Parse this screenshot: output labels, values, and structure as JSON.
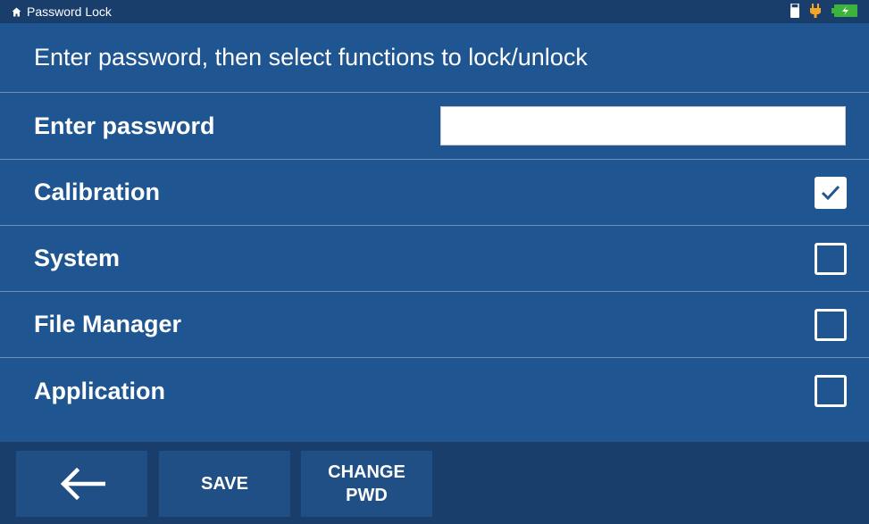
{
  "statusbar": {
    "title": "Password Lock",
    "icons": [
      "home-icon",
      "usb-icon",
      "power-plug-icon",
      "battery-charging-icon"
    ],
    "colors": {
      "plug": "#f5a623",
      "battery": "#3cb43c"
    }
  },
  "heading": "Enter password, then select functions to lock/unlock",
  "password": {
    "label": "Enter password",
    "value": "",
    "placeholder": ""
  },
  "functions": [
    {
      "label": "Calibration",
      "checked": true
    },
    {
      "label": "System",
      "checked": false
    },
    {
      "label": "File Manager",
      "checked": false
    },
    {
      "label": "Application",
      "checked": false
    }
  ],
  "bottom": {
    "back_icon": "arrow-left-icon",
    "save_label": "SAVE",
    "change_pwd_line1": "CHANGE",
    "change_pwd_line2": "PWD"
  }
}
